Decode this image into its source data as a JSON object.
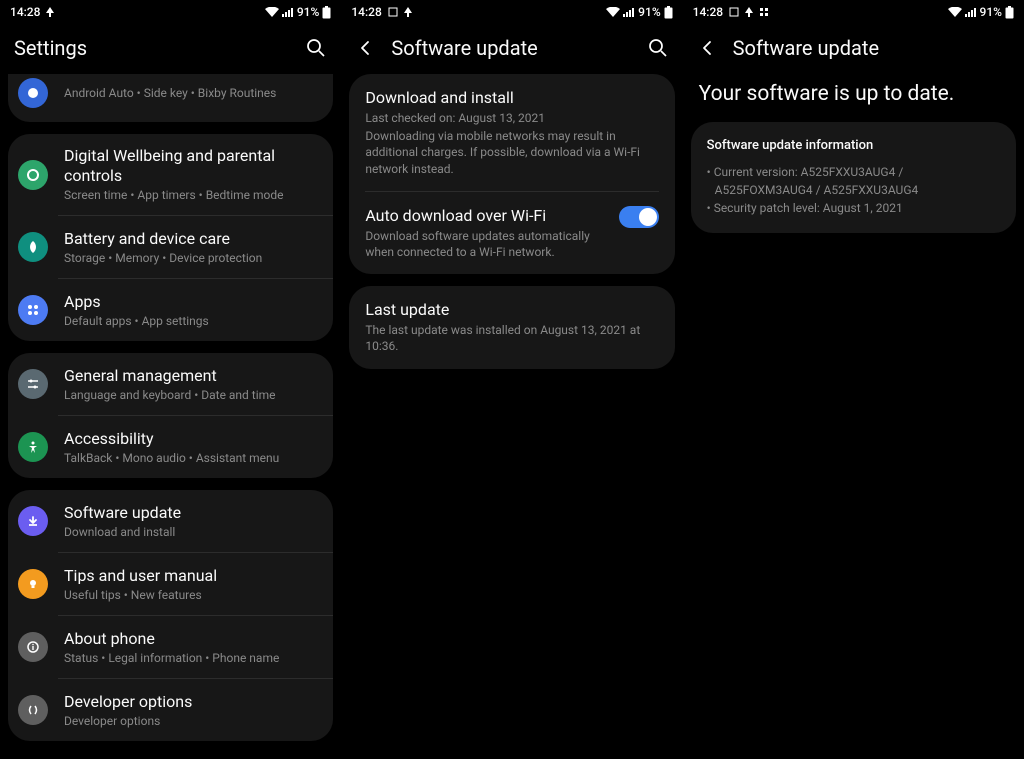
{
  "status": {
    "time": "14:28",
    "battery": "91%"
  },
  "screen1": {
    "title": "Settings",
    "groups": [
      {
        "clipped_top": true,
        "items": [
          {
            "icon": "advanced",
            "title": "",
            "sub": "Android Auto  •  Side key  •  Bixby Routines",
            "clipped": true
          }
        ]
      },
      {
        "items": [
          {
            "icon": "wellbeing",
            "bg": "#2da56b",
            "title": "Digital Wellbeing and parental controls",
            "sub": "Screen time  •  App timers  •  Bedtime mode"
          },
          {
            "icon": "battery",
            "bg": "#0f8f7f",
            "title": "Battery and device care",
            "sub": "Storage  •  Memory  •  Device protection"
          },
          {
            "icon": "apps",
            "bg": "#4d7bf3",
            "title": "Apps",
            "sub": "Default apps  •  App settings"
          }
        ]
      },
      {
        "items": [
          {
            "icon": "general",
            "bg": "#5a6971",
            "title": "General management",
            "sub": "Language and keyboard  •  Date and time"
          },
          {
            "icon": "accessibility",
            "bg": "#1c9452",
            "title": "Accessibility",
            "sub": "TalkBack  •  Mono audio  •  Assistant menu"
          }
        ]
      },
      {
        "items": [
          {
            "icon": "swupdate",
            "bg": "#6b5df0",
            "title": "Software update",
            "sub": "Download and install"
          },
          {
            "icon": "tips",
            "bg": "#f39b1f",
            "title": "Tips and user manual",
            "sub": "Useful tips  •  New features"
          },
          {
            "icon": "about",
            "bg": "#5f5f5f",
            "title": "About phone",
            "sub": "Status  •  Legal information  •  Phone name"
          },
          {
            "icon": "dev",
            "bg": "#5f5f5f",
            "title": "Developer options",
            "sub": "Developer options"
          }
        ]
      }
    ]
  },
  "screen2": {
    "title": "Software update",
    "card1": {
      "download_title": "Download and install",
      "download_checked": "Last checked on: August 13, 2021",
      "download_note": "Downloading via mobile networks may result in additional charges. If possible, download via a Wi-Fi network instead.",
      "auto_title": "Auto download over Wi-Fi",
      "auto_desc": "Download software updates automatically when connected to a Wi-Fi network."
    },
    "card2": {
      "title": "Last update",
      "desc": "The last update was installed on August 13, 2021 at 10:36."
    }
  },
  "screen3": {
    "title": "Software update",
    "heading": "Your software is up to date.",
    "info_title": "Software update information",
    "lines": [
      "Current version: A525FXXU3AUG4 / A525FOXM3AUG4 / A525FXXU3AUG4",
      "Security patch level: August 1, 2021"
    ]
  }
}
